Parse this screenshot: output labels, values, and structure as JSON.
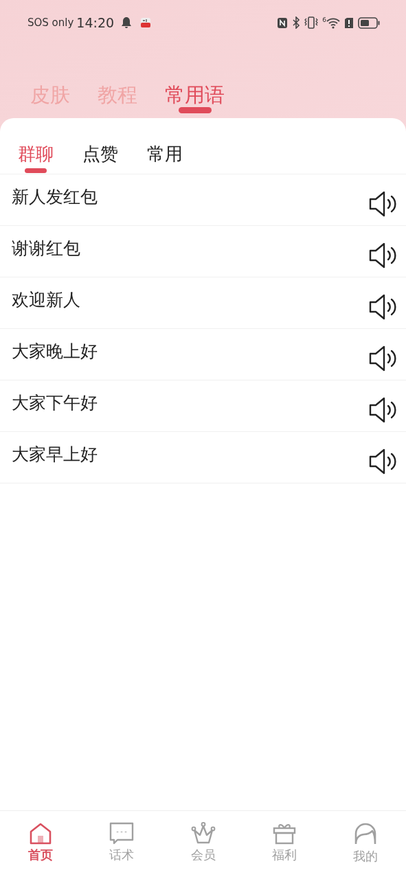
{
  "status_bar": {
    "carrier": "SOS only",
    "time": "14:20",
    "wifi_label": "6"
  },
  "top_tabs": [
    {
      "label": "皮肤",
      "selected": false
    },
    {
      "label": "教程",
      "selected": false
    },
    {
      "label": "常用语",
      "selected": true
    }
  ],
  "sub_tabs": [
    {
      "label": "群聊",
      "selected": true
    },
    {
      "label": "点赞",
      "selected": false
    },
    {
      "label": "常用",
      "selected": false
    }
  ],
  "phrases": [
    {
      "text": "新人发红包"
    },
    {
      "text": "谢谢红包"
    },
    {
      "text": "欢迎新人"
    },
    {
      "text": "大家晚上好"
    },
    {
      "text": "大家下午好"
    },
    {
      "text": "大家早上好"
    }
  ],
  "bottom_nav": [
    {
      "label": "首页",
      "kind": "home",
      "selected": true
    },
    {
      "label": "话术",
      "kind": "chat",
      "selected": false
    },
    {
      "label": "会员",
      "kind": "crown",
      "selected": false
    },
    {
      "label": "福利",
      "kind": "gift",
      "selected": false
    },
    {
      "label": "我的",
      "kind": "profile",
      "selected": false
    }
  ]
}
